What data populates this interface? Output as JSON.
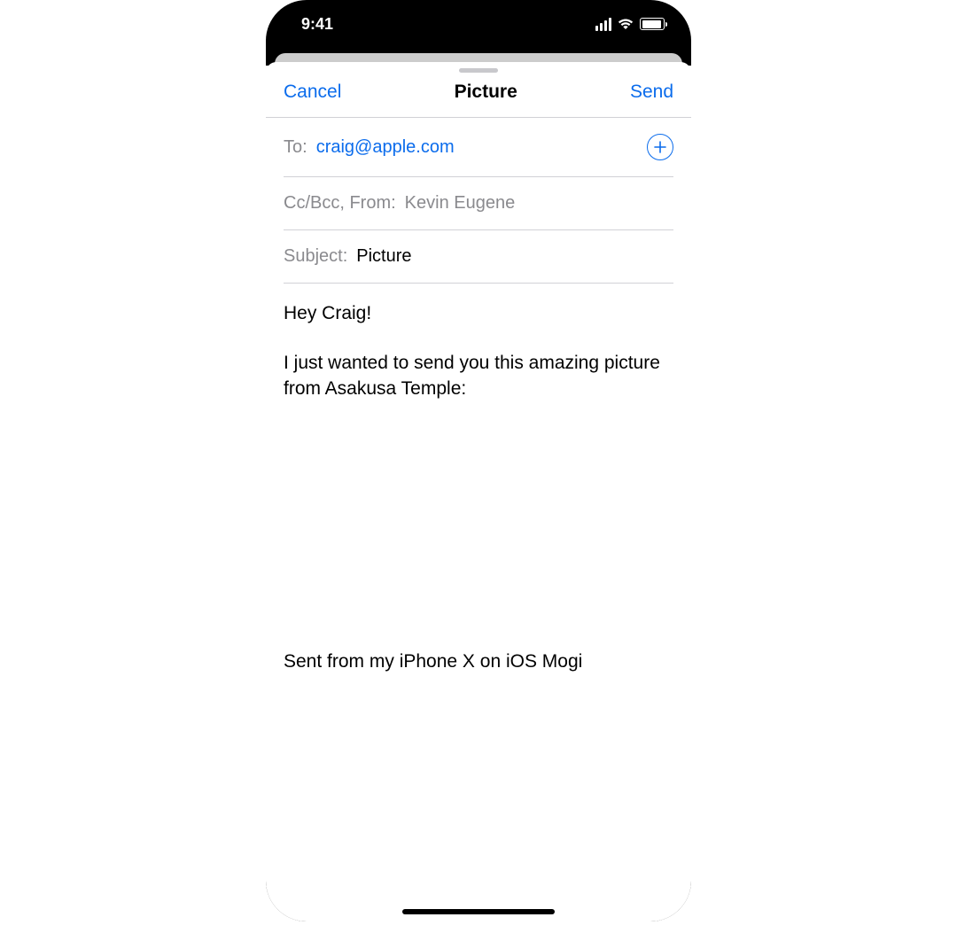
{
  "statusBar": {
    "time": "9:41"
  },
  "nav": {
    "cancel": "Cancel",
    "title": "Picture",
    "send": "Send"
  },
  "fields": {
    "toLabel": "To:",
    "toValue": "craig@apple.com",
    "ccLabel": "Cc/Bcc, From:",
    "ccValue": "Kevin Eugene",
    "subjectLabel": "Subject:",
    "subjectValue": "Picture"
  },
  "body": {
    "p1": "Hey Craig!",
    "p2": "I just wanted to send you this amazing picture from Asakusa Temple:",
    "signature": "Sent from my iPhone X on iOS Mogi"
  }
}
